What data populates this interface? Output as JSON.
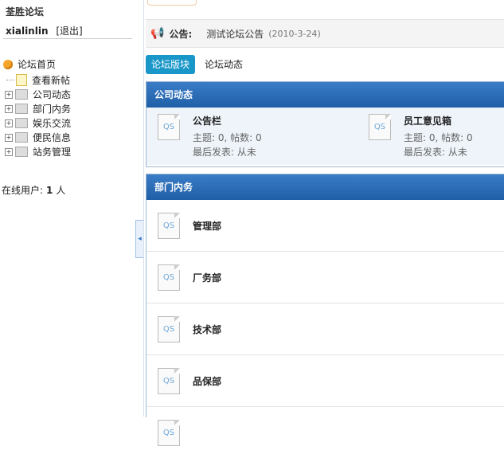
{
  "sidebar": {
    "title": "荃胜论坛",
    "username": "xialinlin",
    "logout": "[退出]",
    "tree_root": "论坛首页",
    "items": [
      {
        "label": "查看新帖"
      },
      {
        "label": "公司动态"
      },
      {
        "label": "部门内务"
      },
      {
        "label": "娱乐交流"
      },
      {
        "label": "便民信息"
      },
      {
        "label": "站务管理"
      }
    ],
    "online_label": "在线用户:",
    "online_count": "1",
    "online_unit": "人"
  },
  "notice": {
    "label": "公告:",
    "text": "测试论坛公告",
    "date": "(2010-3-24)"
  },
  "tabs": {
    "active": "论坛版块",
    "other": "论坛动态"
  },
  "sections": [
    {
      "title": "公司动态",
      "forums": [
        {
          "name": "公告栏",
          "stats": "主题: 0, 帖数: 0",
          "last": "最后发表: 从未"
        },
        {
          "name": "员工意见箱",
          "stats": "主题: 0, 帖数: 0",
          "last": "最后发表: 从未"
        }
      ]
    },
    {
      "title": "部门内务",
      "forums": [
        {
          "name": "管理部"
        },
        {
          "name": "厂务部"
        },
        {
          "name": "技术部"
        },
        {
          "name": "品保部"
        }
      ]
    }
  ],
  "icons": {
    "forum_icon_text": "QS"
  },
  "colors": {
    "header_blue": "#2a6db8",
    "tab_active": "#1a97c9",
    "body_tint": "#eef4fa"
  }
}
